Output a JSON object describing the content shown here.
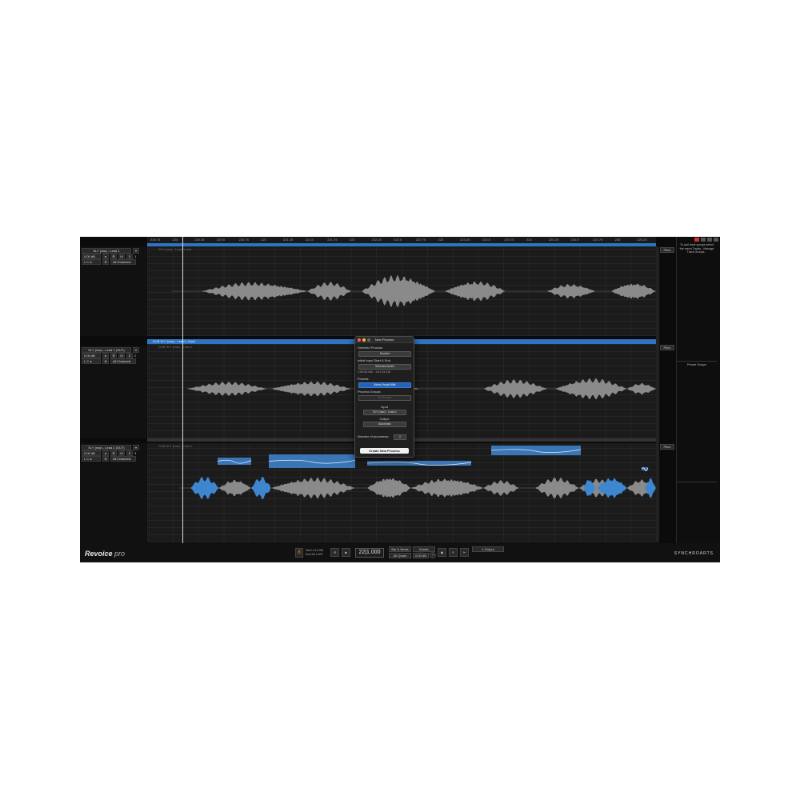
{
  "ruler": {
    "ticks": [
      "219.75",
      "220",
      "220.25",
      "220.5",
      "220.75",
      "221",
      "221.25",
      "221.5",
      "221.75",
      "222",
      "222.25",
      "222.5",
      "222.75",
      "223",
      "223.25",
      "223.5",
      "223.75",
      "224",
      "224.25",
      "224.5",
      "224.75",
      "225",
      "225.25"
    ]
  },
  "tracks": [
    {
      "name": "SLY (raw) - Lead 1",
      "gain": "0.00 dB",
      "channels": "All Channels",
      "number": "1",
      "lane_title": "SLY (raw) - Lead 1.wav",
      "pitch_label": "Pitch"
    },
    {
      "name": "SLY (raw) - Lead 1 (OUT)",
      "gain": "0.00 dB",
      "channels": "All Channels",
      "number": "2",
      "selected_title": "DUB SLY (raw) - Lead 1.2wav",
      "lane_title": "DUB SLY (raw) - Lead 1",
      "pitch_label": "Pitch"
    },
    {
      "name": "SLY (raw) - Lead 2 (OUT)",
      "gain": "0.00 dB",
      "channels": "All Channels",
      "number": "3",
      "lane_title": "DUB SLY (raw) - Lead 1",
      "pitch_label": "Pitch"
    }
  ],
  "right_panel": {
    "help_text": "To add track groups select the menu Tracks - Manage Track Groups...",
    "private_groups": "Private Groups"
  },
  "dialog": {
    "title": "New Process",
    "selected_process_label": "Selected Process",
    "selected_process_value": "Doubler",
    "initial_io_label": "Initial Input Start & End",
    "initial_io_value": "Selected Audio",
    "time_range": "1:00:53.440 - 1:01:13.315",
    "presets_label": "Presets",
    "presets_value": "Mono Vocal Wild",
    "process_groups_label": "Process Groups",
    "process_groups_value": "All Groups",
    "input_label": "Input",
    "input_value": "SLY (raw) - Lead 1",
    "output_label": "Output",
    "output_value": "Automatic",
    "num_processes_label": "Number of processes:",
    "num_processes_value": "2",
    "create_button": "Create New Process"
  },
  "bottom_bar": {
    "logo_main": "Revoice",
    "logo_sub": "pro",
    "start_label": "Start 4:11.000",
    "end_label": "End 96:1.000",
    "bpm": "22|1.000",
    "btn_a": "Bar & Beats",
    "btn_b": "Alt Quant",
    "btn_c": "Elastic Volume",
    "gain": "0.00 dB",
    "output_menu": "1-Output",
    "brand": "SYNCHROARTS"
  },
  "colors": {
    "accent": "#2f74c4",
    "waveform": "#8a8a8a",
    "highlight_wave": "#3f86d0",
    "background": "#0b0b0b"
  }
}
